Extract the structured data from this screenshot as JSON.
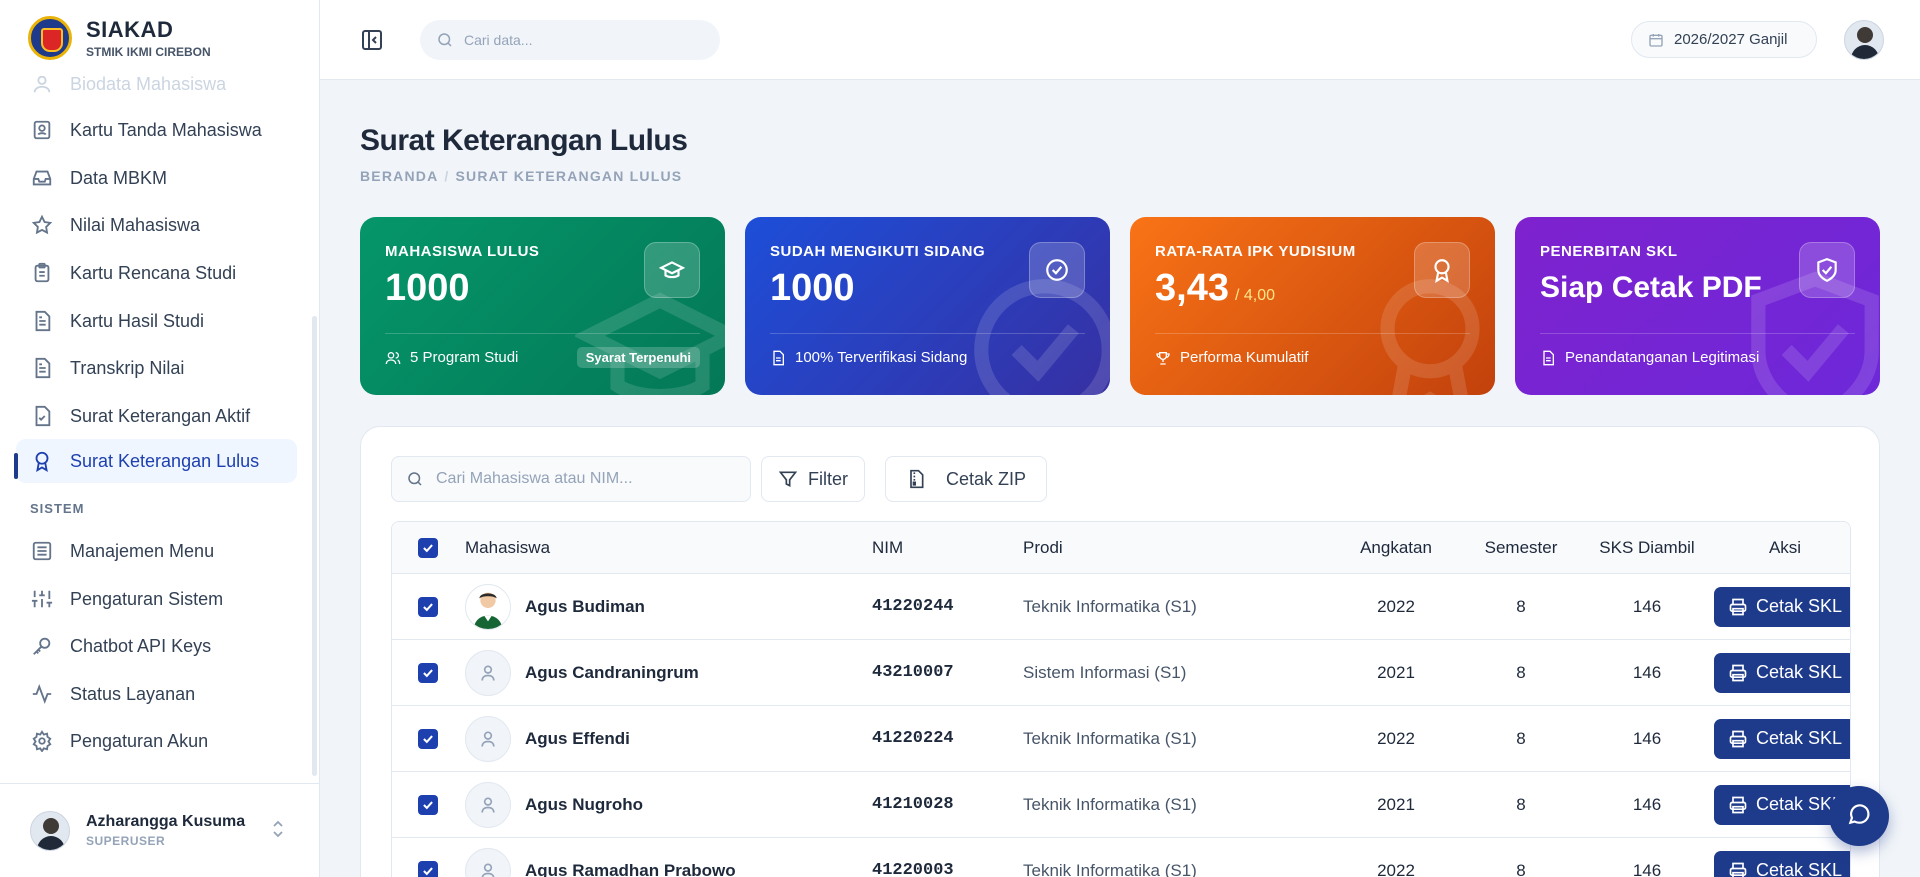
{
  "brand": {
    "title": "SIAKAD",
    "subtitle": "STMIK IKMI CIREBON"
  },
  "sidebar": {
    "items": [
      {
        "label": "Biodata Mahasiswa",
        "icon": "user-icon"
      },
      {
        "label": "Kartu Tanda Mahasiswa",
        "icon": "id-card-icon"
      },
      {
        "label": "Data MBKM",
        "icon": "inbox-icon"
      },
      {
        "label": "Nilai Mahasiswa",
        "icon": "star-icon"
      },
      {
        "label": "Kartu Rencana Studi",
        "icon": "clipboard-icon"
      },
      {
        "label": "Kartu Hasil Studi",
        "icon": "file-text-icon"
      },
      {
        "label": "Transkrip Nilai",
        "icon": "file-text-icon"
      },
      {
        "label": "Surat Keterangan Aktif",
        "icon": "file-check-icon"
      },
      {
        "label": "Surat Keterangan Lulus",
        "icon": "award-icon"
      }
    ],
    "section_label": "SISTEM",
    "system_items": [
      {
        "label": "Manajemen Menu",
        "icon": "list-icon"
      },
      {
        "label": "Pengaturan Sistem",
        "icon": "sliders-icon"
      },
      {
        "label": "Chatbot API Keys",
        "icon": "key-icon"
      },
      {
        "label": "Status Layanan",
        "icon": "activity-icon"
      },
      {
        "label": "Pengaturan Akun",
        "icon": "gear-icon"
      }
    ],
    "user": {
      "name": "Azharangga Kusuma",
      "role": "SUPERUSER"
    }
  },
  "header": {
    "search_placeholder": "Cari data...",
    "period": "2026/2027 Ganjil"
  },
  "page": {
    "title": "Surat Keterangan Lulus",
    "breadcrumb": [
      "BERANDA",
      "SURAT KETERANGAN LULUS"
    ]
  },
  "cards": [
    {
      "label": "MAHASISWA LULUS",
      "value": "1000",
      "footer": "5 Program Studi",
      "badge": "Syarat Terpenuhi",
      "color": "#059669",
      "icon": "graduation-cap-icon"
    },
    {
      "label": "SUDAH MENGIKUTI SIDANG",
      "value": "1000",
      "footer": "100% Terverifikasi Sidang",
      "color": "#1d4ed8",
      "icon": "check-circle-icon"
    },
    {
      "label": "RATA-RATA IPK YUDISIUM",
      "value": "3,43",
      "suffix": "/ 4,00",
      "footer": "Performa Kumulatif",
      "color": "#f97316",
      "icon": "award-icon"
    },
    {
      "label": "PENERBITAN SKL",
      "value": "Siap Cetak PDF",
      "footer": "Penandatanganan Legitimasi",
      "color": "#7e22ce",
      "icon": "shield-check-icon"
    }
  ],
  "table": {
    "search_placeholder": "Cari Mahasiswa atau NIM...",
    "filter_label": "Filter",
    "zip_label": "Cetak ZIP",
    "columns": [
      "Mahasiswa",
      "NIM",
      "Prodi",
      "Angkatan",
      "Semester",
      "SKS Diambil",
      "Aksi"
    ],
    "action_label": "Cetak SKL",
    "rows": [
      {
        "name": "Agus Budiman",
        "nim": "41220244",
        "prodi": "Teknik Informatika (S1)",
        "angkatan": "2022",
        "semester": "8",
        "sks": "146",
        "photo": true
      },
      {
        "name": "Agus Candraningrum",
        "nim": "43210007",
        "prodi": "Sistem Informasi (S1)",
        "angkatan": "2021",
        "semester": "8",
        "sks": "146",
        "photo": false
      },
      {
        "name": "Agus Effendi",
        "nim": "41220224",
        "prodi": "Teknik Informatika (S1)",
        "angkatan": "2022",
        "semester": "8",
        "sks": "146",
        "photo": false
      },
      {
        "name": "Agus Nugroho",
        "nim": "41210028",
        "prodi": "Teknik Informatika (S1)",
        "angkatan": "2021",
        "semester": "8",
        "sks": "146",
        "photo": false
      },
      {
        "name": "Agus Ramadhan Prabowo",
        "nim": "41220003",
        "prodi": "Teknik Informatika (S1)",
        "angkatan": "2022",
        "semester": "8",
        "sks": "146",
        "photo": false
      }
    ]
  },
  "colors": {
    "primary": "#1e3a8a",
    "active_bg": "#eff6ff",
    "checkbox": "#1e40af"
  }
}
